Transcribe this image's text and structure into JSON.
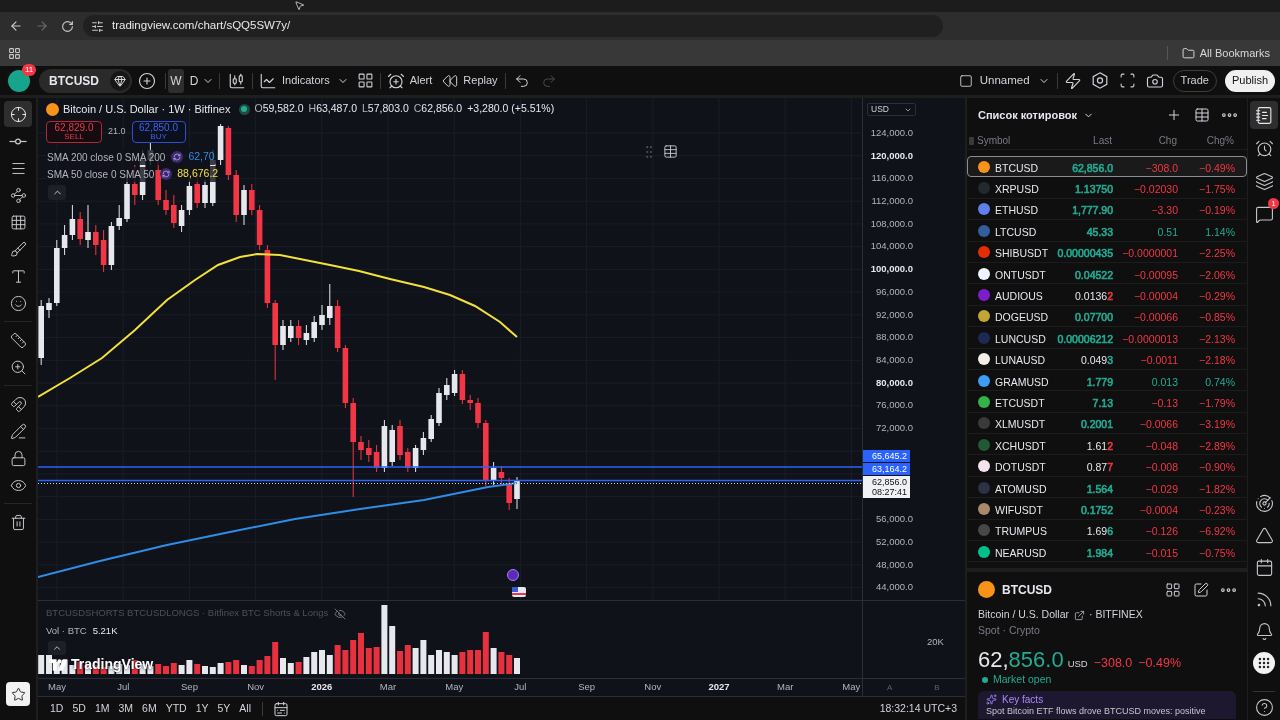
{
  "browser": {
    "url": "tradingview.com/chart/sQQ5SW7y/",
    "bookmarks": "All Bookmarks"
  },
  "top_toolbar": {
    "avatar_badge": "11",
    "symbol": "BTCUSD",
    "intervals": [
      {
        "label": "W",
        "selected": true
      },
      {
        "label": "D",
        "selected": false
      }
    ],
    "indicators": "Indicators",
    "alert": "Alert",
    "replay": "Replay",
    "history": [
      {
        "kind": "undo",
        "disabled": false
      },
      {
        "kind": "redo",
        "disabled": true
      }
    ],
    "layout_name": "Unnamed",
    "trade": "Trade",
    "publish": "Publish"
  },
  "left_toolbar": {
    "groups": [
      [
        {
          "kind": "crosshair",
          "selected": true
        },
        {
          "kind": "trend_line",
          "selected": false
        },
        {
          "kind": "horizontal_lines",
          "selected": false
        },
        {
          "kind": "pattern",
          "selected": false
        },
        {
          "kind": "projection",
          "selected": false
        },
        {
          "kind": "brush",
          "selected": false
        },
        {
          "kind": "text",
          "selected": false
        },
        {
          "kind": "emoji",
          "selected": false
        }
      ],
      [
        {
          "kind": "ruler",
          "selected": false
        },
        {
          "kind": "zoom",
          "selected": false
        }
      ],
      [
        {
          "kind": "magnet",
          "selected": false
        },
        {
          "kind": "stay_in_drawing",
          "selected": false
        },
        {
          "kind": "lock",
          "selected": false
        },
        {
          "kind": "visibility",
          "selected": false
        }
      ],
      [
        {
          "kind": "trash",
          "selected": false
        }
      ]
    ]
  },
  "chart": {
    "legend": {
      "title": "Bitcoin / U.S. Dollar · 1W · Bitfinex",
      "market_open": true,
      "ohlc": [
        {
          "label": "O",
          "value": "59,582.0"
        },
        {
          "label": "H",
          "value": "63,487.0"
        },
        {
          "label": "L",
          "value": "57,803.0"
        },
        {
          "label": "C",
          "value": "62,856.0"
        }
      ],
      "change": "+3,280.0 (+5.51%)"
    },
    "trade_buttons": {
      "sell_price": "62,829.0",
      "sell": "SELL",
      "spread": "21.0",
      "buy_price": "62,850.0",
      "buy": "BUY"
    },
    "indicators": [
      {
        "label": "SMA 200 close 0 SMA 200",
        "value": "62,70",
        "color": "#2e8de6"
      },
      {
        "label": "SMA 50 close 0 SMA 50",
        "value": "88,676.2",
        "color": "#f2e13a"
      }
    ],
    "price_axis": {
      "currency": "USD",
      "labels": [
        {
          "kind": "tick",
          "text": "124,000.0",
          "major": false
        },
        {
          "kind": "tick",
          "text": "120,000.0",
          "major": true
        },
        {
          "kind": "tick",
          "text": "116,000.0",
          "major": false
        },
        {
          "kind": "tick",
          "text": "112,000.0",
          "major": false
        },
        {
          "kind": "tick",
          "text": "108,000.0",
          "major": false
        },
        {
          "kind": "tick",
          "text": "104,000.0",
          "major": false
        },
        {
          "kind": "tick",
          "text": "100,000.0",
          "major": true
        },
        {
          "kind": "tick",
          "text": "96,000.0",
          "major": false
        },
        {
          "kind": "tick",
          "text": "92,000.0",
          "major": false
        },
        {
          "kind": "tick",
          "text": "88,000.0",
          "major": false
        },
        {
          "kind": "tick",
          "text": "84,000.0",
          "major": false
        },
        {
          "kind": "tick",
          "text": "80,000.0",
          "major": true
        },
        {
          "kind": "tick",
          "text": "76,000.0",
          "major": false
        },
        {
          "kind": "tick",
          "text": "72,000.0",
          "major": false
        },
        {
          "kind": "line_marker",
          "text": "65,645.2"
        },
        {
          "kind": "line_marker",
          "text": "63,164.2"
        },
        {
          "kind": "last_price",
          "text": "62,856.0",
          "countdown": "08:27:41"
        },
        {
          "kind": "tick",
          "text": "56,000.0",
          "major": false
        },
        {
          "kind": "tick",
          "text": "52,000.0",
          "major": false
        },
        {
          "kind": "tick",
          "text": "48,000.0",
          "major": false
        },
        {
          "kind": "tick",
          "text": "44,000.0",
          "major": false
        }
      ]
    },
    "volume_pane": {
      "study": {
        "label": "BTCUSDSHORTS BTCUSDLONGS · Bitfinex BTC Shorts & Longs",
        "hidden": true
      },
      "volume": {
        "label": "Vol · BTC",
        "value": "5.21K"
      },
      "axis_label": "20K"
    },
    "logo": "TradingView",
    "time_axis": {
      "labels": [
        {
          "text": "May",
          "major": false
        },
        {
          "text": "Jul",
          "major": false
        },
        {
          "text": "Sep",
          "major": false
        },
        {
          "text": "Nov",
          "major": false
        },
        {
          "text": "2026",
          "major": true
        },
        {
          "text": "Mar",
          "major": false
        },
        {
          "text": "May",
          "major": false
        },
        {
          "text": "Jul",
          "major": false
        },
        {
          "text": "Sep",
          "major": false
        },
        {
          "text": "Nov",
          "major": false
        },
        {
          "text": "2027",
          "major": true
        },
        {
          "text": "Mar",
          "major": false
        },
        {
          "text": "May",
          "major": false
        }
      ],
      "scale_buttons": [
        "A",
        "B"
      ]
    }
  },
  "range_bar": {
    "ranges": [
      "1D",
      "5D",
      "1M",
      "3M",
      "6M",
      "YTD",
      "1Y",
      "5Y",
      "All"
    ],
    "clock": "18:32:14 UTC+3"
  },
  "watchlist": {
    "title": "Список котировок",
    "columns": [
      "Symbol",
      "Last",
      "Chg",
      "Chg%"
    ],
    "rows": [
      {
        "symbol": "BTCUSD",
        "color": "#f7931a",
        "selected": true,
        "last": [
          {
            "text": "62,856.0",
            "color": "#22ab94"
          }
        ],
        "chg": "−308.0",
        "chg_pct": "−0.49%",
        "rising": false
      },
      {
        "symbol": "XRPUSD",
        "color": "#23292f",
        "selected": false,
        "last": [
          {
            "text": "1.13750",
            "color": "#22ab94"
          }
        ],
        "chg": "−0.02030",
        "chg_pct": "−1.75%",
        "rising": false
      },
      {
        "symbol": "ETHUSD",
        "color": "#627eea",
        "selected": false,
        "last": [
          {
            "text": "1,777.90",
            "color": "#22ab94"
          }
        ],
        "chg": "−3.30",
        "chg_pct": "−0.19%",
        "rising": false
      },
      {
        "symbol": "LTCUSD",
        "color": "#345d9d",
        "selected": false,
        "last": [
          {
            "text": "45.33",
            "color": "#22ab94"
          }
        ],
        "chg": "0.51",
        "chg_pct": "1.14%",
        "rising": true
      },
      {
        "symbol": "SHIBUSDT",
        "color": "#e42d04",
        "selected": false,
        "last": [
          {
            "text": "0.00000435",
            "color": "#22ab94"
          }
        ],
        "chg": "−0.0000001",
        "chg_pct": "−2.25%",
        "rising": false
      },
      {
        "symbol": "ONTUSDT",
        "color": "#eef3ff",
        "selected": false,
        "last": [
          {
            "text": "0.04522",
            "color": "#22ab94"
          }
        ],
        "chg": "−0.00095",
        "chg_pct": "−2.06%",
        "rising": false
      },
      {
        "symbol": "AUDIOUS",
        "color": "#7e1bcc",
        "selected": false,
        "last": [
          {
            "text": "0.0136"
          },
          {
            "text": "2",
            "color": "#f23645"
          }
        ],
        "chg": "−0.00004",
        "chg_pct": "−0.29%",
        "rising": false
      },
      {
        "symbol": "DOGEUSD",
        "color": "#c2a633",
        "selected": false,
        "last": [
          {
            "text": "0.07700",
            "color": "#22ab94"
          }
        ],
        "chg": "−0.00066",
        "chg_pct": "−0.85%",
        "rising": false
      },
      {
        "symbol": "LUNCUSD",
        "color": "#1b2a55",
        "selected": false,
        "last": [
          {
            "text": "0.00006212",
            "color": "#22ab94"
          }
        ],
        "chg": "−0.0000013",
        "chg_pct": "−2.13%",
        "rising": false
      },
      {
        "symbol": "LUNAUSD",
        "color": "#f3eee6",
        "selected": false,
        "last": [
          {
            "text": "0.049"
          },
          {
            "text": "3",
            "color": "#22ab94"
          }
        ],
        "chg": "−0.0011",
        "chg_pct": "−2.18%",
        "rising": false
      },
      {
        "symbol": "GRAMUSD",
        "color": "#3d9df5",
        "selected": false,
        "last": [
          {
            "text": "1.779",
            "color": "#22ab94"
          }
        ],
        "chg": "0.013",
        "chg_pct": "0.74%",
        "rising": true
      },
      {
        "symbol": "ETCUSDT",
        "color": "#33b249",
        "selected": false,
        "last": [
          {
            "text": "7.13",
            "color": "#22ab94"
          }
        ],
        "chg": "−0.13",
        "chg_pct": "−1.79%",
        "rising": false
      },
      {
        "symbol": "XLMUSDT",
        "color": "#3a3a3a",
        "selected": false,
        "last": [
          {
            "text": "0.2001",
            "color": "#22ab94"
          }
        ],
        "chg": "−0.0066",
        "chg_pct": "−3.19%",
        "rising": false
      },
      {
        "symbol": "XCHUSDT",
        "color": "#1f5a32",
        "selected": false,
        "last": [
          {
            "text": "1.61"
          },
          {
            "text": "2",
            "color": "#f23645"
          }
        ],
        "chg": "−0.048",
        "chg_pct": "−2.89%",
        "rising": false
      },
      {
        "symbol": "DOTUSDT",
        "color": "#f4e3ec",
        "selected": false,
        "last": [
          {
            "text": "0.87"
          },
          {
            "text": "7",
            "color": "#f23645"
          }
        ],
        "chg": "−0.008",
        "chg_pct": "−0.90%",
        "rising": false
      },
      {
        "symbol": "ATOMUSD",
        "color": "#2e3148",
        "selected": false,
        "last": [
          {
            "text": "1.564",
            "color": "#22ab94"
          }
        ],
        "chg": "−0.029",
        "chg_pct": "−1.82%",
        "rising": false
      },
      {
        "symbol": "WIFUSDT",
        "color": "#a88a6b",
        "selected": false,
        "last": [
          {
            "text": "0.1752",
            "color": "#22ab94"
          }
        ],
        "chg": "−0.0004",
        "chg_pct": "−0.23%",
        "rising": false
      },
      {
        "symbol": "TRUMPUS",
        "color": "#474747",
        "selected": false,
        "last": [
          {
            "text": "1.69"
          },
          {
            "text": "6",
            "color": "#22ab94"
          }
        ],
        "chg": "−0.126",
        "chg_pct": "−6.92%",
        "rising": false
      },
      {
        "symbol": "NEARUSD",
        "color": "#00c08b",
        "selected": false,
        "last": [
          {
            "text": "1.984",
            "color": "#22ab94"
          }
        ],
        "chg": "−0.015",
        "chg_pct": "−0.75%",
        "rising": false
      }
    ]
  },
  "symbol_details": {
    "symbol": "BTCUSD",
    "description": "Bitcoin / U.S. Dollar",
    "exchange": "· BITFINEX",
    "category": "Spot · Crypto",
    "price": [
      {
        "text": "62,"
      },
      {
        "text": "856.0",
        "color": "#22ab94"
      }
    ],
    "currency": "USD",
    "change": "−308.0",
    "change_pct": "−0.49%",
    "rising": false,
    "market_open": true,
    "market_status": "Market open",
    "key_facts": {
      "title": "Key facts",
      "text": "Spot Bitcoin ETF flows drove BTCUSD moves: positive"
    }
  },
  "right_sidebar": {
    "top": [
      {
        "kind": "watchlist",
        "selected": true
      },
      {
        "kind": "alerts",
        "selected": false
      },
      {
        "kind": "object_tree",
        "selected": false
      },
      {
        "kind": "chats",
        "selected": false,
        "badge": "1"
      }
    ],
    "bottom": [
      {
        "kind": "radar",
        "selected": false
      },
      {
        "kind": "pine",
        "selected": false
      },
      {
        "kind": "calendar",
        "selected": false
      },
      {
        "kind": "news",
        "selected": false
      },
      {
        "kind": "notifications",
        "selected": false
      },
      {
        "kind": "apps",
        "selected": false
      }
    ],
    "help": {
      "kind": "help",
      "selected": false
    }
  }
}
